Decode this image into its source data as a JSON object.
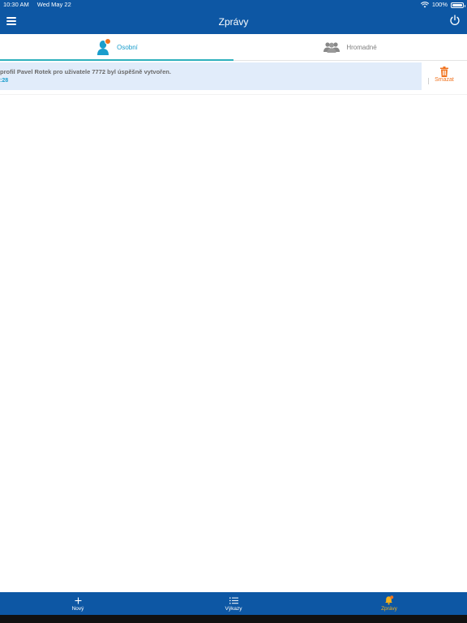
{
  "status_bar": {
    "time": "10:30 AM",
    "date": "Wed May 22",
    "battery": "100%"
  },
  "header": {
    "title": "Zprávy"
  },
  "tabs": [
    {
      "label": "Osobní",
      "active": true,
      "icon": "person-icon"
    },
    {
      "label": "Hromadné",
      "active": false,
      "icon": "group-icon"
    }
  ],
  "messages": [
    {
      "text": "profil Pavel Rotek pro uživatele 7772 byl úspěšně vytvořen.",
      "time": ":28"
    }
  ],
  "actions": {
    "delete_label": "Smazat"
  },
  "bottom_tabs": [
    {
      "label": "Nový",
      "icon": "plus-icon",
      "active": false
    },
    {
      "label": "Výkazy",
      "icon": "list-icon",
      "active": false
    },
    {
      "label": "Zprávy",
      "icon": "bell-icon",
      "active": true
    }
  ],
  "colors": {
    "primary": "#0d57a4",
    "accent": "#1a9dcc",
    "orange": "#f0731f",
    "active_tab": "#f6b11a",
    "message_bg": "#e1ecfa"
  }
}
